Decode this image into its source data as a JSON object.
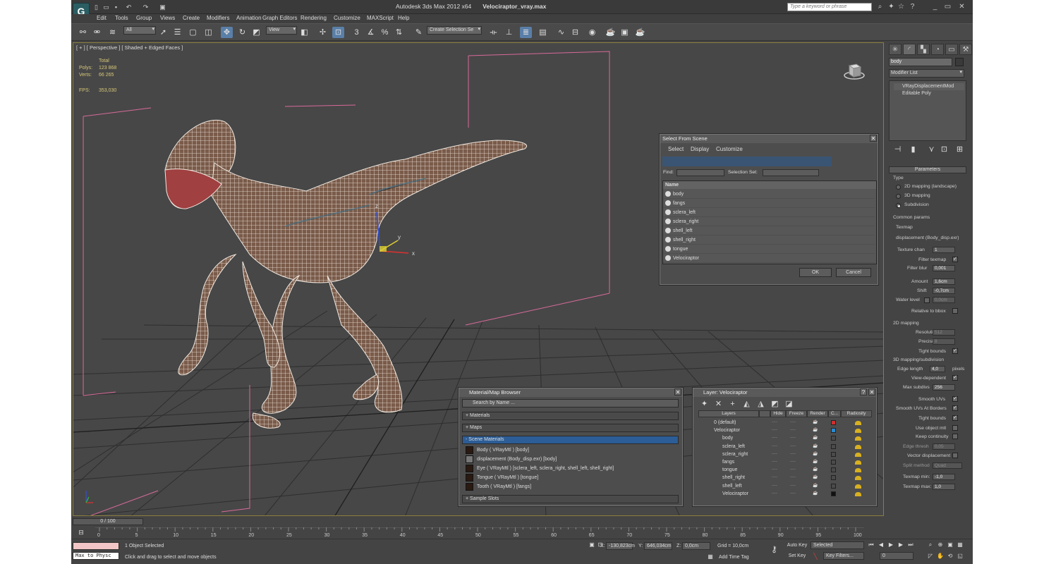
{
  "window": {
    "app_title": "Autodesk 3ds Max  2012 x64",
    "file_title": "Velociraptor_vray.max",
    "search_placeholder": "Type a keyword or phrase"
  },
  "menu": [
    "Edit",
    "Tools",
    "Group",
    "Views",
    "Create",
    "Modifiers",
    "Animation",
    "Graph Editors",
    "Rendering",
    "Customize",
    "MAXScript",
    "Help"
  ],
  "toolbar": {
    "filter": "All",
    "coord": "View",
    "selection_set": "Create Selection Se"
  },
  "viewport": {
    "label": "[ + ] [ Perspective ] [ Shaded + Edged Faces ]",
    "stats_total": "Total",
    "polys_label": "Polys:",
    "polys": "123 868",
    "verts_label": "Verts:",
    "verts": "66 265",
    "fps_label": "FPS:",
    "fps": "353,030",
    "axis_x": "x",
    "axis_y": "y",
    "axis_z": "z"
  },
  "cmd": {
    "object_name": "body",
    "modifier_list": "Modifier List",
    "stack": [
      "VRayDisplacementMod",
      "Editable Poly"
    ],
    "parameters": "Parameters",
    "type": "Type",
    "type_opts": [
      "2D mapping (landscape)",
      "3D mapping",
      "Subdivision"
    ],
    "common": "Common params",
    "texmap": "Texmap",
    "texmap_val": "displacement (Body_disp.exr)",
    "texture_chan": "Texture chan",
    "texture_chan_v": "1",
    "filter_texmap": "Filter texmap",
    "filter_blur": "Filter blur",
    "filter_blur_v": "0,001",
    "amount": "Amount",
    "amount_v": "1,6cm",
    "shift": "Shift",
    "shift_v": "-0,7cm",
    "water": "Water level",
    "water_v": "0,0cm",
    "relbbox": "Relative to bbox",
    "mapping2d": "2D mapping",
    "resolution": "Resolution",
    "resolution_v": "512",
    "precision": "Precision",
    "precision_v": "8",
    "tight_bounds": "Tight bounds",
    "mapping3d": "3D mapping/subdivision",
    "edge_length": "Edge length",
    "edge_length_v": "4,0",
    "pixels": "pixels",
    "view_dep": "View-dependent",
    "max_subdivs": "Max subdivs",
    "max_subdivs_v": "256",
    "smooth_uvs": "Smooth UVs",
    "smooth_uvs_borders": "Smooth UVs At Borders",
    "tight_bounds2": "Tight bounds",
    "use_obj_mtl": "Use object mtl",
    "keep_cont": "Keep continuity",
    "edge_thresh": "Edge thresh",
    "edge_thresh_v": "0,05",
    "vector_disp": "Vector displacement",
    "split_method": "Split method",
    "split_method_v": "Quad",
    "texmap_min": "Texmap min:",
    "texmap_min_v": "-1,0",
    "texmap_max": "Texmap max:",
    "texmap_max_v": "1,0"
  },
  "select_scene": {
    "title": "Select From Scene",
    "menus": [
      "Select",
      "Display",
      "Customize"
    ],
    "find": "Find:",
    "selection_set": "Selection Set:",
    "name_col": "Name",
    "items": [
      "body",
      "fangs",
      "sclera_left",
      "sclera_right",
      "shell_left",
      "shell_right",
      "tongue",
      "Velociraptor"
    ],
    "ok": "OK",
    "cancel": "Cancel"
  },
  "mat_browser": {
    "title": "Material/Map Browser",
    "search": "Search by Name ...",
    "materials": "+ Materials",
    "maps": "+ Maps",
    "scene_materials": "- Scene Materials",
    "items": [
      "Body  ( VRayMtl )  [body]",
      "displacement (Body_disp.exr) [body]",
      "Eye  ( VRayMtl )  [sclera_left, sclera_right, shell_left, shell_right]",
      "Tongue  ( VRayMtl )  [tongue]",
      "Tooth  ( VRayMtl )  [fangs]"
    ],
    "sample_slots": "+ Sample Slots"
  },
  "layer_dlg": {
    "title": "Layer: Velociraptor",
    "cols": [
      "Layers",
      "Hide",
      "Freeze",
      "Render",
      "C...",
      "Radiosity"
    ],
    "rows": [
      "0 (default)",
      "Velociraptor",
      "body",
      "sclera_left",
      "sclera_right",
      "fangs",
      "tongue",
      "shell_right",
      "shell_left",
      "Velociraptor"
    ]
  },
  "timeline": {
    "slider": "0 / 100",
    "ticks": [
      "0",
      "5",
      "10",
      "15",
      "20",
      "25",
      "30",
      "35",
      "40",
      "45",
      "50",
      "55",
      "60",
      "65",
      "70",
      "75",
      "80",
      "85",
      "90",
      "95",
      "100"
    ]
  },
  "status": {
    "selected": "1 Object Selected",
    "prompt": "Click and drag to select and move objects",
    "maxscript": "Max to Physc",
    "x_label": "X:",
    "x": "-130,823cm",
    "y_label": "Y:",
    "y": "646,034cm",
    "z_label": "Z:",
    "z": "0,0cm",
    "grid": "Grid = 10,0cm",
    "autokey": "Auto Key",
    "setkey": "Set Key",
    "sel_combo": "Selected",
    "key_filters": "Key Filters...",
    "add_time_tag": "Add Time Tag",
    "frame": "0"
  },
  "colors": {
    "accent": "#2c5d96",
    "viewport_bg": "#474747",
    "wire": "#f0e8e0",
    "gizmo_pink": "#d86a9a"
  }
}
